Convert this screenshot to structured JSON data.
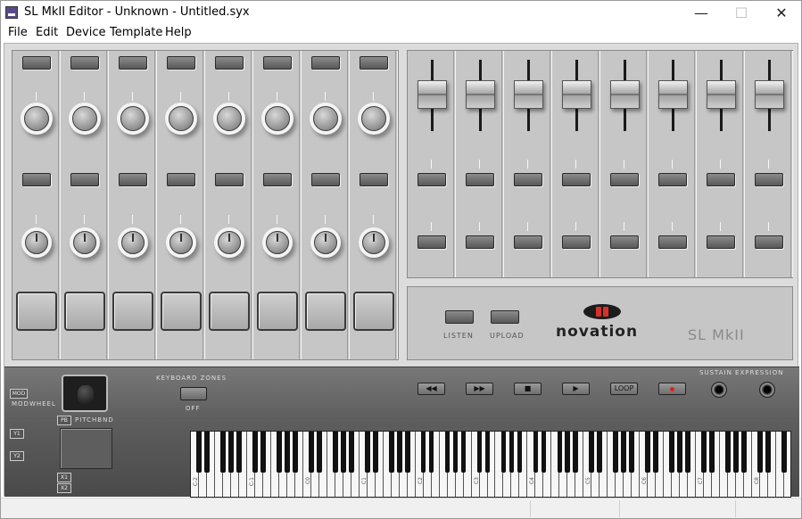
{
  "window": {
    "title": "SL MkII Editor - Unknown - Untitled.syx",
    "minimize": "—",
    "maximize": "☐",
    "close": "✕"
  },
  "menu": [
    "File",
    "Edit",
    "Device",
    "Template",
    "Help"
  ],
  "left_strips": {
    "count": 8
  },
  "right_strips": {
    "count": 8
  },
  "logo_panel": {
    "listen_label": "LISTEN",
    "upload_label": "UPLOAD",
    "brand": "novation",
    "model": "SL MkII",
    "brand_colors": {
      "dot": "#d83028",
      "oval": "#1c1c1c"
    }
  },
  "controls": {
    "mod_label": "MOD",
    "modwheel_label": "MODWHEEL",
    "pb_label": "PB",
    "pitchbend_label": "PITCHBND",
    "y1_label": "Y1",
    "y2_label": "Y2",
    "x1_label": "X1",
    "x2_label": "X2",
    "keyboard_zones_label": "KEYBOARD ZONES",
    "keyboard_zones_state": "OFF",
    "sustain_expression_label": "SUSTAIN EXPRESSION"
  },
  "transport": {
    "rewind_icon": "◀◀",
    "forward_icon": "▶▶",
    "stop_icon": "■",
    "play_icon": "▶",
    "loop_label": "LOOP",
    "record_color": "#e02020"
  },
  "keyboard": {
    "octave_labels": [
      "C-2",
      "C-1",
      "C0",
      "C1",
      "C2",
      "C3",
      "C4",
      "C5",
      "C6",
      "C7",
      "C8"
    ]
  }
}
